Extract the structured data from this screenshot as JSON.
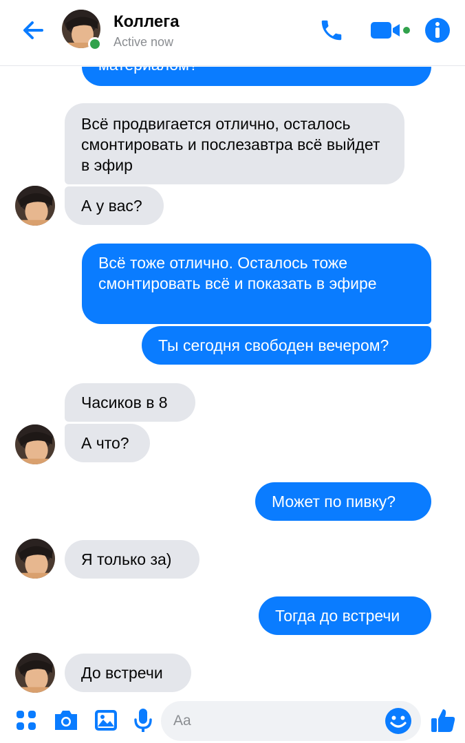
{
  "header": {
    "contact_name": "Коллега",
    "status": "Active now",
    "icons": [
      "back-arrow-icon",
      "phone-icon",
      "video-camera-icon",
      "info-icon"
    ]
  },
  "messages": [
    {
      "side": "out",
      "text": "материалом?"
    },
    {
      "side": "in",
      "text": "Всё продвигается отлично, осталось смонтировать и послезавтра всё выйдет в эфир"
    },
    {
      "side": "in",
      "text": "А у вас?"
    },
    {
      "side": "out",
      "text": "Всё тоже отлично. Осталось тоже смонтировать всё и показать в эфире"
    },
    {
      "side": "out",
      "text": "Ты сегодня свободен вечером?"
    },
    {
      "side": "in",
      "text": "Часиков в 8"
    },
    {
      "side": "in",
      "text": "А что?"
    },
    {
      "side": "out",
      "text": "Может по пивку?"
    },
    {
      "side": "in",
      "text": "Я только за)"
    },
    {
      "side": "out",
      "text": "Тогда до встречи"
    },
    {
      "side": "in",
      "text": "До встречи"
    }
  ],
  "composer": {
    "placeholder": "Aa",
    "icons": [
      "apps-grid-icon",
      "camera-icon",
      "gallery-icon",
      "microphone-icon",
      "emoji-icon",
      "thumbs-up-icon"
    ]
  },
  "colors": {
    "accent": "#0a7cff",
    "incoming_bubble": "#e4e6eb",
    "online": "#31a24c"
  }
}
